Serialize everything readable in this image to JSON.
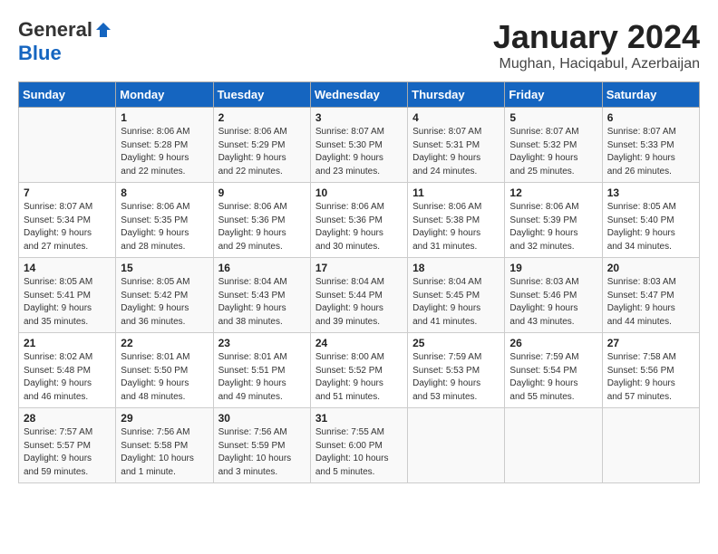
{
  "header": {
    "logo_general": "General",
    "logo_blue": "Blue",
    "month": "January 2024",
    "location": "Mughan, Haciqabul, Azerbaijan"
  },
  "days_of_week": [
    "Sunday",
    "Monday",
    "Tuesday",
    "Wednesday",
    "Thursday",
    "Friday",
    "Saturday"
  ],
  "weeks": [
    [
      {
        "day": "",
        "info": ""
      },
      {
        "day": "1",
        "info": "Sunrise: 8:06 AM\nSunset: 5:28 PM\nDaylight: 9 hours\nand 22 minutes."
      },
      {
        "day": "2",
        "info": "Sunrise: 8:06 AM\nSunset: 5:29 PM\nDaylight: 9 hours\nand 22 minutes."
      },
      {
        "day": "3",
        "info": "Sunrise: 8:07 AM\nSunset: 5:30 PM\nDaylight: 9 hours\nand 23 minutes."
      },
      {
        "day": "4",
        "info": "Sunrise: 8:07 AM\nSunset: 5:31 PM\nDaylight: 9 hours\nand 24 minutes."
      },
      {
        "day": "5",
        "info": "Sunrise: 8:07 AM\nSunset: 5:32 PM\nDaylight: 9 hours\nand 25 minutes."
      },
      {
        "day": "6",
        "info": "Sunrise: 8:07 AM\nSunset: 5:33 PM\nDaylight: 9 hours\nand 26 minutes."
      }
    ],
    [
      {
        "day": "7",
        "info": "Sunrise: 8:07 AM\nSunset: 5:34 PM\nDaylight: 9 hours\nand 27 minutes."
      },
      {
        "day": "8",
        "info": "Sunrise: 8:06 AM\nSunset: 5:35 PM\nDaylight: 9 hours\nand 28 minutes."
      },
      {
        "day": "9",
        "info": "Sunrise: 8:06 AM\nSunset: 5:36 PM\nDaylight: 9 hours\nand 29 minutes."
      },
      {
        "day": "10",
        "info": "Sunrise: 8:06 AM\nSunset: 5:36 PM\nDaylight: 9 hours\nand 30 minutes."
      },
      {
        "day": "11",
        "info": "Sunrise: 8:06 AM\nSunset: 5:38 PM\nDaylight: 9 hours\nand 31 minutes."
      },
      {
        "day": "12",
        "info": "Sunrise: 8:06 AM\nSunset: 5:39 PM\nDaylight: 9 hours\nand 32 minutes."
      },
      {
        "day": "13",
        "info": "Sunrise: 8:05 AM\nSunset: 5:40 PM\nDaylight: 9 hours\nand 34 minutes."
      }
    ],
    [
      {
        "day": "14",
        "info": "Sunrise: 8:05 AM\nSunset: 5:41 PM\nDaylight: 9 hours\nand 35 minutes."
      },
      {
        "day": "15",
        "info": "Sunrise: 8:05 AM\nSunset: 5:42 PM\nDaylight: 9 hours\nand 36 minutes."
      },
      {
        "day": "16",
        "info": "Sunrise: 8:04 AM\nSunset: 5:43 PM\nDaylight: 9 hours\nand 38 minutes."
      },
      {
        "day": "17",
        "info": "Sunrise: 8:04 AM\nSunset: 5:44 PM\nDaylight: 9 hours\nand 39 minutes."
      },
      {
        "day": "18",
        "info": "Sunrise: 8:04 AM\nSunset: 5:45 PM\nDaylight: 9 hours\nand 41 minutes."
      },
      {
        "day": "19",
        "info": "Sunrise: 8:03 AM\nSunset: 5:46 PM\nDaylight: 9 hours\nand 43 minutes."
      },
      {
        "day": "20",
        "info": "Sunrise: 8:03 AM\nSunset: 5:47 PM\nDaylight: 9 hours\nand 44 minutes."
      }
    ],
    [
      {
        "day": "21",
        "info": "Sunrise: 8:02 AM\nSunset: 5:48 PM\nDaylight: 9 hours\nand 46 minutes."
      },
      {
        "day": "22",
        "info": "Sunrise: 8:01 AM\nSunset: 5:50 PM\nDaylight: 9 hours\nand 48 minutes."
      },
      {
        "day": "23",
        "info": "Sunrise: 8:01 AM\nSunset: 5:51 PM\nDaylight: 9 hours\nand 49 minutes."
      },
      {
        "day": "24",
        "info": "Sunrise: 8:00 AM\nSunset: 5:52 PM\nDaylight: 9 hours\nand 51 minutes."
      },
      {
        "day": "25",
        "info": "Sunrise: 7:59 AM\nSunset: 5:53 PM\nDaylight: 9 hours\nand 53 minutes."
      },
      {
        "day": "26",
        "info": "Sunrise: 7:59 AM\nSunset: 5:54 PM\nDaylight: 9 hours\nand 55 minutes."
      },
      {
        "day": "27",
        "info": "Sunrise: 7:58 AM\nSunset: 5:56 PM\nDaylight: 9 hours\nand 57 minutes."
      }
    ],
    [
      {
        "day": "28",
        "info": "Sunrise: 7:57 AM\nSunset: 5:57 PM\nDaylight: 9 hours\nand 59 minutes."
      },
      {
        "day": "29",
        "info": "Sunrise: 7:56 AM\nSunset: 5:58 PM\nDaylight: 10 hours\nand 1 minute."
      },
      {
        "day": "30",
        "info": "Sunrise: 7:56 AM\nSunset: 5:59 PM\nDaylight: 10 hours\nand 3 minutes."
      },
      {
        "day": "31",
        "info": "Sunrise: 7:55 AM\nSunset: 6:00 PM\nDaylight: 10 hours\nand 5 minutes."
      },
      {
        "day": "",
        "info": ""
      },
      {
        "day": "",
        "info": ""
      },
      {
        "day": "",
        "info": ""
      }
    ]
  ]
}
